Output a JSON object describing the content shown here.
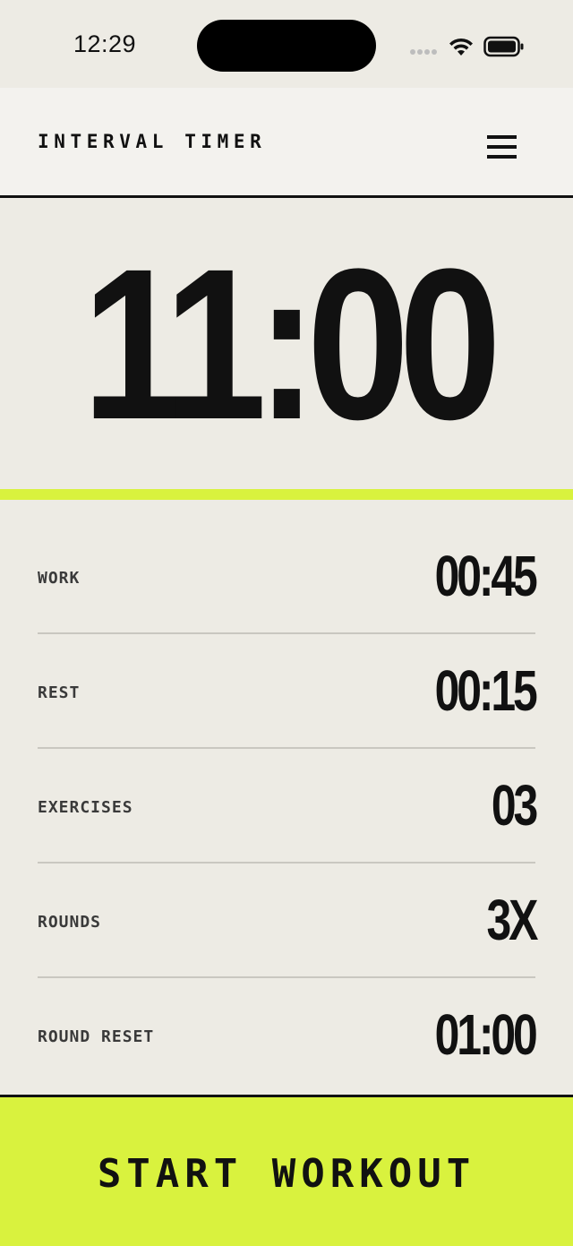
{
  "status_bar": {
    "time": "12:29",
    "icons": [
      "cellular-signal-icon",
      "wifi-icon",
      "battery-icon"
    ]
  },
  "header": {
    "title": "INTERVAL TIMER",
    "menu_icon": "hamburger-menu-icon"
  },
  "timer": {
    "display": "11:00"
  },
  "settings": [
    {
      "label": "WORK",
      "value": "00:45"
    },
    {
      "label": "REST",
      "value": "00:15"
    },
    {
      "label": "EXERCISES",
      "value": "03"
    },
    {
      "label": "ROUNDS",
      "value": "3X"
    },
    {
      "label": "ROUND RESET",
      "value": "01:00"
    }
  ],
  "start_button": {
    "label": "START WORKOUT"
  },
  "colors": {
    "background": "#EDEBE4",
    "header_background": "#F3F2EE",
    "accent": "#D9F23E",
    "text": "#111111",
    "divider": "#C9C7C0"
  }
}
